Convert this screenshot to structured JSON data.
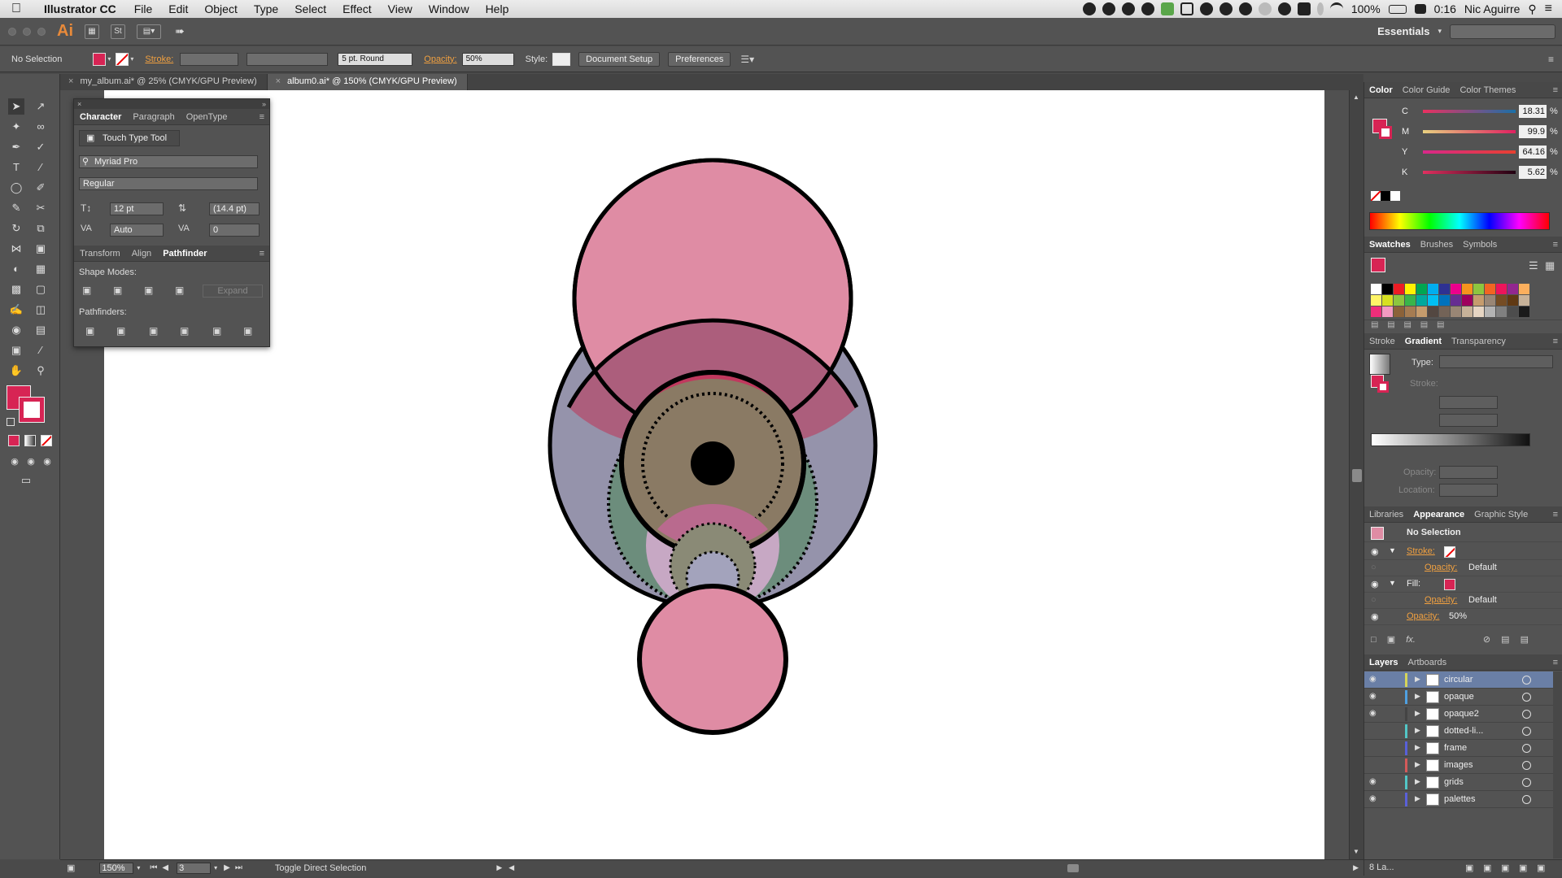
{
  "menubar": {
    "app_name": "Illustrator CC",
    "items": [
      "File",
      "Edit",
      "Object",
      "Type",
      "Select",
      "Effect",
      "View",
      "Window",
      "Help"
    ],
    "battery": "100%",
    "time": "0:16",
    "user": "Nic Aguirre"
  },
  "topbar": {
    "logo": "Ai",
    "st_label": "St",
    "workspace": "Essentials"
  },
  "control_bar": {
    "selection": "No Selection",
    "stroke_label": "Stroke:",
    "brush": "5 pt. Round",
    "opacity_label": "Opacity:",
    "opacity_value": "50%",
    "style_label": "Style:",
    "document_setup": "Document Setup",
    "preferences": "Preferences"
  },
  "doc_tabs": [
    {
      "label": "my_album.ai* @ 25% (CMYK/GPU Preview)",
      "active": false
    },
    {
      "label": "album0.ai* @ 150% (CMYK/GPU Preview)",
      "active": true
    }
  ],
  "character_panel": {
    "tabs": [
      "Character",
      "Paragraph",
      "OpenType"
    ],
    "touch_type": "Touch Type Tool",
    "font_family": "Myriad Pro",
    "font_style": "Regular",
    "font_size": "12 pt",
    "leading": "(14.4 pt)",
    "kerning": "Auto",
    "tracking": "0",
    "sub_tabs": [
      "Transform",
      "Align",
      "Pathfinder"
    ],
    "shape_modes": "Shape Modes:",
    "expand": "Expand",
    "pathfinders": "Pathfinders:"
  },
  "color_panel": {
    "tabs": [
      "Color",
      "Color Guide",
      "Color Themes"
    ],
    "channels": [
      {
        "label": "C",
        "value": "18.31"
      },
      {
        "label": "M",
        "value": "99.9"
      },
      {
        "label": "Y",
        "value": "64.16"
      },
      {
        "label": "K",
        "value": "5.62"
      }
    ],
    "pct": "%"
  },
  "swatches_panel": {
    "tabs": [
      "Swatches",
      "Brushes",
      "Symbols"
    ],
    "colors": [
      "#ffffff",
      "#000000",
      "#ed1c24",
      "#fff200",
      "#00a651",
      "#00aeef",
      "#2e3192",
      "#ec008c",
      "#f7941d",
      "#8dc63f",
      "#f26522",
      "#ed145b",
      "#92278f",
      "#fbaf5d",
      "#fff568",
      "#d7e021",
      "#8dc63f",
      "#39b54a",
      "#00a99d",
      "#00bff3",
      "#0072bc",
      "#662d91",
      "#9e005d",
      "#c69c6d",
      "#998675",
      "#754c24",
      "#603913",
      "#c7b299",
      "#ee2e7a",
      "#f49ac1",
      "#8c6239",
      "#a67c52",
      "#c69c6d",
      "#534741",
      "#736357",
      "#998675",
      "#c7b299",
      "#e6d5c3",
      "#b3b3b3",
      "#808080",
      "#4d4d4d",
      "#1a1a1a"
    ]
  },
  "gradient_panel": {
    "tabs": [
      "Stroke",
      "Gradient",
      "Transparency"
    ],
    "type_label": "Type:",
    "stroke_label": "Stroke:",
    "opacity_label": "Opacity:",
    "location_label": "Location:"
  },
  "appearance_panel": {
    "tabs": [
      "Libraries",
      "Appearance",
      "Graphic Style"
    ],
    "title": "No Selection",
    "rows": [
      {
        "label": "Stroke:",
        "kind": "stroke"
      },
      {
        "label": "Opacity:",
        "value": "Default",
        "kind": "sub"
      },
      {
        "label": "Fill:",
        "kind": "fill"
      },
      {
        "label": "Opacity:",
        "value": "Default",
        "kind": "sub"
      },
      {
        "label": "Opacity:",
        "value": "50%",
        "kind": "top"
      }
    ],
    "fx": "fx."
  },
  "layers_panel": {
    "tabs": [
      "Layers",
      "Artboards"
    ],
    "layers": [
      {
        "name": "circular",
        "color": "#d4d45a",
        "visible": true,
        "selected": true
      },
      {
        "name": "opaque",
        "color": "#4fa0e0",
        "visible": true,
        "selected": false
      },
      {
        "name": "opaque2",
        "color": "#444444",
        "visible": true,
        "selected": false
      },
      {
        "name": "dotted-li...",
        "color": "#52c6c6",
        "visible": false,
        "selected": false
      },
      {
        "name": "frame",
        "color": "#5860d8",
        "visible": false,
        "selected": false
      },
      {
        "name": "images",
        "color": "#d45a5a",
        "visible": false,
        "selected": false
      },
      {
        "name": "grids",
        "color": "#52c6c6",
        "visible": true,
        "selected": false
      },
      {
        "name": "palettes",
        "color": "#5a60d8",
        "visible": true,
        "selected": false
      }
    ],
    "count": "8 La..."
  },
  "statusbar": {
    "zoom": "150%",
    "page": "3",
    "message": "Toggle Direct Selection"
  },
  "colors": {
    "fill": "#d72454",
    "pink": "#df8ca4",
    "lavender": "#9593ab",
    "olive": "#8a7a64",
    "green": "#6c8d7c",
    "dark_pink": "#ac5e7c",
    "crimson": "#c0395e"
  }
}
